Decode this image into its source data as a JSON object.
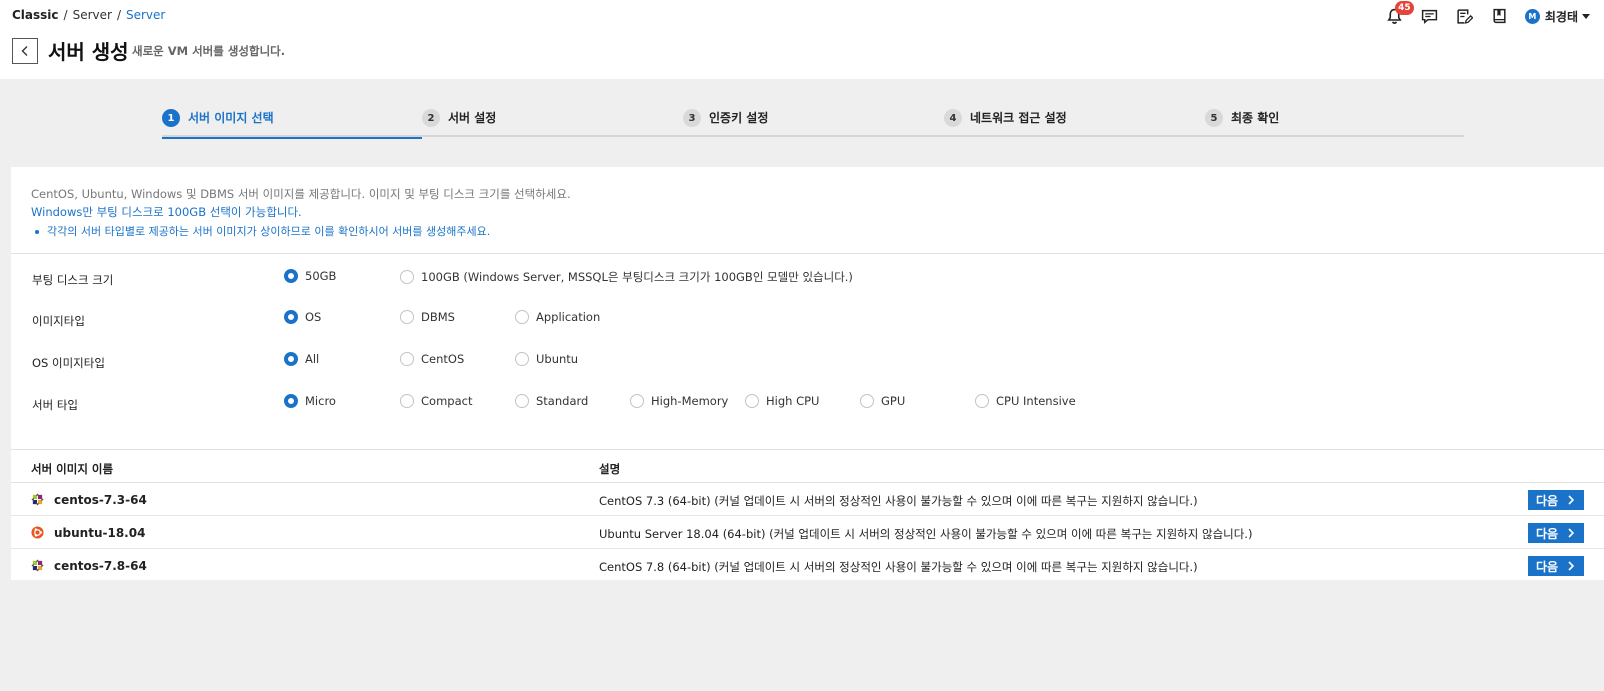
{
  "breadcrumb": {
    "items": [
      "Classic",
      "Server",
      "Server"
    ],
    "sep": "/"
  },
  "header": {
    "notification_count": "45",
    "user_initial": "M",
    "user_name": "최경태"
  },
  "page": {
    "title": "서버 생성",
    "description": "새로운 VM 서버를 생성합니다."
  },
  "steps": [
    {
      "num": "1",
      "label": "서버 이미지 선택",
      "active": true
    },
    {
      "num": "2",
      "label": "서버 설정",
      "active": false
    },
    {
      "num": "3",
      "label": "인증키 설정",
      "active": false
    },
    {
      "num": "4",
      "label": "네트워크 접근 설정",
      "active": false
    },
    {
      "num": "5",
      "label": "최종 확인",
      "active": false
    }
  ],
  "info": {
    "line1": "CentOS, Ubuntu, Windows 및 DBMS 서버 이미지를 제공합니다. 이미지 및 부팅 디스크 크기를 선택하세요.",
    "line2": "Windows만 부팅 디스크로 100GB 선택이 가능합니다.",
    "line3": "각각의 서버 타입별로 제공하는 서버 이미지가 상이하므로 이를 확인하시어 서버를 생성해주세요."
  },
  "options": {
    "boot_disk": {
      "label": "부팅 디스크 크기",
      "choices": [
        "50GB",
        "100GB (Windows Server, MSSQL은 부팅디스크 크기가 100GB인 모델만 있습니다.)"
      ],
      "selected": 0
    },
    "image_type": {
      "label": "이미지타입",
      "choices": [
        "OS",
        "DBMS",
        "Application"
      ],
      "selected": 0
    },
    "os_image_type": {
      "label": "OS 이미지타입",
      "choices": [
        "All",
        "CentOS",
        "Ubuntu"
      ],
      "selected": 0
    },
    "server_type": {
      "label": "서버 타입",
      "choices": [
        "Micro",
        "Compact",
        "Standard",
        "High-Memory",
        "High CPU",
        "GPU",
        "CPU Intensive"
      ],
      "selected": 0
    }
  },
  "table": {
    "headers": {
      "name": "서버 이미지 이름",
      "desc": "설명"
    },
    "rows": [
      {
        "os": "centos",
        "name": "centos-7.3-64",
        "desc": "CentOS 7.3 (64-bit) (커널 업데이트 시 서버의 정상적인 사용이 불가능할 수 있으며 이에 따른 복구는 지원하지 않습니다.)",
        "action": "다음"
      },
      {
        "os": "ubuntu",
        "name": "ubuntu-18.04",
        "desc": "Ubuntu Server 18.04 (64-bit) (커널 업데이트 시 서버의 정상적인 사용이 불가능할 수 있으며 이에 따른 복구는 지원하지 않습니다.)",
        "action": "다음"
      },
      {
        "os": "centos",
        "name": "centos-7.8-64",
        "desc": "CentOS 7.8 (64-bit) (커널 업데이트 시 서버의 정상적인 사용이 불가능할 수 있으며 이에 따른 복구는 지원하지 않습니다.)",
        "action": "다음"
      }
    ]
  },
  "colors": {
    "accent": "#1a73c9",
    "badge": "#e5433b",
    "background": "#efefef"
  }
}
